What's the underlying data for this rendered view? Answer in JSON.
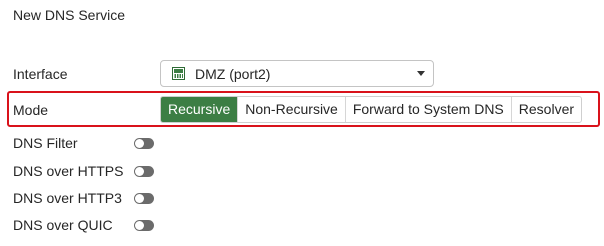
{
  "header": {
    "title": "New DNS Service"
  },
  "interface": {
    "label": "Interface",
    "selected": "DMZ (port2)",
    "icon": "port-icon",
    "dropdown_icon": "caret-down-icon"
  },
  "mode": {
    "label": "Mode",
    "options": [
      "Recursive",
      "Non-Recursive",
      "Forward to System DNS",
      "Resolver"
    ],
    "selected": "Recursive",
    "highlight_color": "#d9121b",
    "active_color": "#3c7e44"
  },
  "toggles": [
    {
      "label": "DNS Filter",
      "enabled": false
    },
    {
      "label": "DNS over HTTPS",
      "enabled": false
    },
    {
      "label": "DNS over HTTP3",
      "enabled": false
    },
    {
      "label": "DNS over QUIC",
      "enabled": false
    }
  ]
}
